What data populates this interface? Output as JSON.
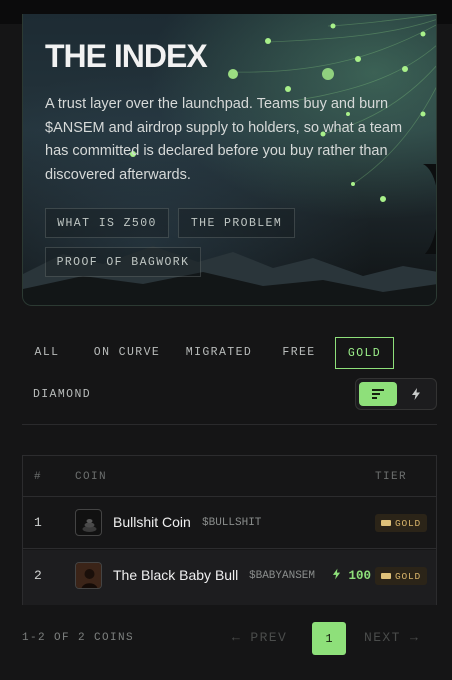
{
  "hero": {
    "title": "THE INDEX",
    "description": "A trust layer over the launchpad. Teams buy and burn $ANSEM and airdrop supply to holders, so what a team has committed is declared before you buy rather than discovered afterwards.",
    "buttons": [
      "WHAT IS Z500",
      "THE PROBLEM",
      "PROOF OF BAGWORK"
    ]
  },
  "filters": {
    "items": [
      "ALL",
      "ON CURVE",
      "MIGRATED",
      "FREE",
      "GOLD",
      "DIAMOND"
    ],
    "active": "GOLD"
  },
  "view_toggle": {
    "options": [
      "list-icon",
      "bolt-icon"
    ],
    "active": "list-icon"
  },
  "table": {
    "headers": {
      "index": "#",
      "coin": "COIN",
      "tier": "TIER"
    },
    "rows": [
      {
        "index": "1",
        "name": "Bullshit Coin",
        "ticker": "$BULLSHIT",
        "boost": "",
        "tier": "GOLD"
      },
      {
        "index": "2",
        "name": "The Black Baby Bull",
        "ticker": "$BABYANSEM",
        "boost": "100",
        "tier": "GOLD"
      }
    ]
  },
  "pagination": {
    "count": "1-2 OF 2 COINS",
    "prev": "← PREV",
    "page": "1",
    "next": "NEXT →"
  },
  "colors": {
    "accent": "#8ee07a",
    "gold": "#d8b46a",
    "background": "#151516"
  }
}
